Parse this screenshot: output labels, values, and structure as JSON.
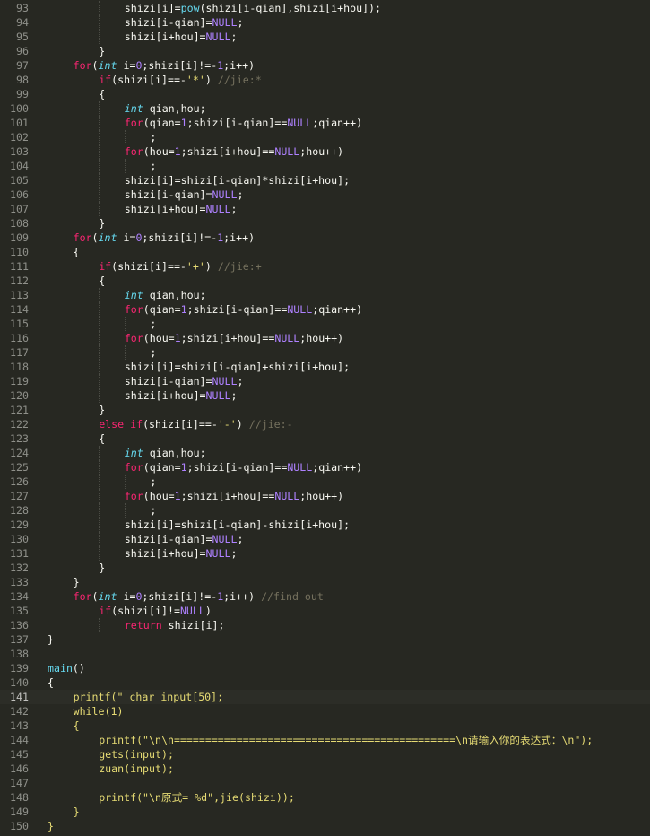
{
  "editor": {
    "theme_colors": {
      "background": "#272822",
      "text": "#f8f8f2",
      "keyword": "#f92672",
      "type": "#66d9ef",
      "number": "#ae81ff",
      "string": "#e6db74",
      "comment": "#75715e",
      "line_number": "#8f908a"
    },
    "current_line": 141,
    "lines": [
      {
        "n": "93",
        "indent": 3,
        "tokens": [
          [
            "pl",
            "shizi[i]="
          ],
          [
            "fn",
            "pow"
          ],
          [
            "pl",
            "(shizi[i-qian],shizi[i+hou]);"
          ]
        ]
      },
      {
        "n": "94",
        "indent": 3,
        "tokens": [
          [
            "pl",
            "shizi[i-qian]="
          ],
          [
            "nm",
            "NULL"
          ],
          [
            "pl",
            ";"
          ]
        ]
      },
      {
        "n": "95",
        "indent": 3,
        "tokens": [
          [
            "pl",
            "shizi[i+hou]="
          ],
          [
            "nm",
            "NULL"
          ],
          [
            "pl",
            ";"
          ]
        ]
      },
      {
        "n": "96",
        "indent": 2,
        "tokens": [
          [
            "pl",
            "}"
          ]
        ]
      },
      {
        "n": "97",
        "indent": 1,
        "tokens": [
          [
            "kw",
            "for"
          ],
          [
            "pl",
            "("
          ],
          [
            "ty",
            "int"
          ],
          [
            "pl",
            " i="
          ],
          [
            "nm",
            "0"
          ],
          [
            "pl",
            ";shizi[i]!=-"
          ],
          [
            "nm",
            "1"
          ],
          [
            "pl",
            ";i++)"
          ]
        ]
      },
      {
        "n": "98",
        "indent": 2,
        "tokens": [
          [
            "kw",
            "if"
          ],
          [
            "pl",
            "(shizi[i]==-"
          ],
          [
            "st",
            "'*'"
          ],
          [
            "pl",
            ") "
          ],
          [
            "cm",
            "//jie:*"
          ]
        ]
      },
      {
        "n": "99",
        "indent": 2,
        "tokens": [
          [
            "pl",
            "{"
          ]
        ]
      },
      {
        "n": "100",
        "indent": 3,
        "tokens": [
          [
            "ty",
            "int"
          ],
          [
            "pl",
            " qian,hou;"
          ]
        ]
      },
      {
        "n": "101",
        "indent": 3,
        "tokens": [
          [
            "kw",
            "for"
          ],
          [
            "pl",
            "(qian="
          ],
          [
            "nm",
            "1"
          ],
          [
            "pl",
            ";shizi[i-qian]=="
          ],
          [
            "nm",
            "NULL"
          ],
          [
            "pl",
            ";qian++)"
          ]
        ]
      },
      {
        "n": "102",
        "indent": 4,
        "tokens": [
          [
            "pl",
            ";"
          ]
        ]
      },
      {
        "n": "103",
        "indent": 3,
        "tokens": [
          [
            "kw",
            "for"
          ],
          [
            "pl",
            "(hou="
          ],
          [
            "nm",
            "1"
          ],
          [
            "pl",
            ";shizi[i+hou]=="
          ],
          [
            "nm",
            "NULL"
          ],
          [
            "pl",
            ";hou++)"
          ]
        ]
      },
      {
        "n": "104",
        "indent": 4,
        "tokens": [
          [
            "pl",
            ";"
          ]
        ]
      },
      {
        "n": "105",
        "indent": 3,
        "tokens": [
          [
            "pl",
            "shizi[i]=shizi[i-qian]*shizi[i+hou];"
          ]
        ]
      },
      {
        "n": "106",
        "indent": 3,
        "tokens": [
          [
            "pl",
            "shizi[i-qian]="
          ],
          [
            "nm",
            "NULL"
          ],
          [
            "pl",
            ";"
          ]
        ]
      },
      {
        "n": "107",
        "indent": 3,
        "tokens": [
          [
            "pl",
            "shizi[i+hou]="
          ],
          [
            "nm",
            "NULL"
          ],
          [
            "pl",
            ";"
          ]
        ]
      },
      {
        "n": "108",
        "indent": 2,
        "tokens": [
          [
            "pl",
            "}"
          ]
        ]
      },
      {
        "n": "109",
        "indent": 1,
        "tokens": [
          [
            "kw",
            "for"
          ],
          [
            "pl",
            "("
          ],
          [
            "ty",
            "int"
          ],
          [
            "pl",
            " i="
          ],
          [
            "nm",
            "0"
          ],
          [
            "pl",
            ";shizi[i]!=-"
          ],
          [
            "nm",
            "1"
          ],
          [
            "pl",
            ";i++)"
          ]
        ]
      },
      {
        "n": "110",
        "indent": 1,
        "tokens": [
          [
            "pl",
            "{"
          ]
        ]
      },
      {
        "n": "111",
        "indent": 2,
        "tokens": [
          [
            "kw",
            "if"
          ],
          [
            "pl",
            "(shizi[i]==-"
          ],
          [
            "st",
            "'+'"
          ],
          [
            "pl",
            ") "
          ],
          [
            "cm",
            "//jie:+"
          ]
        ]
      },
      {
        "n": "112",
        "indent": 2,
        "tokens": [
          [
            "pl",
            "{"
          ]
        ]
      },
      {
        "n": "113",
        "indent": 3,
        "tokens": [
          [
            "ty",
            "int"
          ],
          [
            "pl",
            " qian,hou;"
          ]
        ]
      },
      {
        "n": "114",
        "indent": 3,
        "tokens": [
          [
            "kw",
            "for"
          ],
          [
            "pl",
            "(qian="
          ],
          [
            "nm",
            "1"
          ],
          [
            "pl",
            ";shizi[i-qian]=="
          ],
          [
            "nm",
            "NULL"
          ],
          [
            "pl",
            ";qian++)"
          ]
        ]
      },
      {
        "n": "115",
        "indent": 4,
        "tokens": [
          [
            "pl",
            ";"
          ]
        ]
      },
      {
        "n": "116",
        "indent": 3,
        "tokens": [
          [
            "kw",
            "for"
          ],
          [
            "pl",
            "(hou="
          ],
          [
            "nm",
            "1"
          ],
          [
            "pl",
            ";shizi[i+hou]=="
          ],
          [
            "nm",
            "NULL"
          ],
          [
            "pl",
            ";hou++)"
          ]
        ]
      },
      {
        "n": "117",
        "indent": 4,
        "tokens": [
          [
            "pl",
            ";"
          ]
        ]
      },
      {
        "n": "118",
        "indent": 3,
        "tokens": [
          [
            "pl",
            "shizi[i]=shizi[i-qian]+shizi[i+hou];"
          ]
        ]
      },
      {
        "n": "119",
        "indent": 3,
        "tokens": [
          [
            "pl",
            "shizi[i-qian]="
          ],
          [
            "nm",
            "NULL"
          ],
          [
            "pl",
            ";"
          ]
        ]
      },
      {
        "n": "120",
        "indent": 3,
        "tokens": [
          [
            "pl",
            "shizi[i+hou]="
          ],
          [
            "nm",
            "NULL"
          ],
          [
            "pl",
            ";"
          ]
        ]
      },
      {
        "n": "121",
        "indent": 2,
        "tokens": [
          [
            "pl",
            "}"
          ]
        ]
      },
      {
        "n": "122",
        "indent": 2,
        "tokens": [
          [
            "kw",
            "else"
          ],
          [
            "pl",
            " "
          ],
          [
            "kw",
            "if"
          ],
          [
            "pl",
            "(shizi[i]==-"
          ],
          [
            "st",
            "'-'"
          ],
          [
            "pl",
            ") "
          ],
          [
            "cm",
            "//jie:-"
          ]
        ]
      },
      {
        "n": "123",
        "indent": 2,
        "tokens": [
          [
            "pl",
            "{"
          ]
        ]
      },
      {
        "n": "124",
        "indent": 3,
        "tokens": [
          [
            "ty",
            "int"
          ],
          [
            "pl",
            " qian,hou;"
          ]
        ]
      },
      {
        "n": "125",
        "indent": 3,
        "tokens": [
          [
            "kw",
            "for"
          ],
          [
            "pl",
            "(qian="
          ],
          [
            "nm",
            "1"
          ],
          [
            "pl",
            ";shizi[i-qian]=="
          ],
          [
            "nm",
            "NULL"
          ],
          [
            "pl",
            ";qian++)"
          ]
        ]
      },
      {
        "n": "126",
        "indent": 4,
        "tokens": [
          [
            "pl",
            ";"
          ]
        ]
      },
      {
        "n": "127",
        "indent": 3,
        "tokens": [
          [
            "kw",
            "for"
          ],
          [
            "pl",
            "(hou="
          ],
          [
            "nm",
            "1"
          ],
          [
            "pl",
            ";shizi[i+hou]=="
          ],
          [
            "nm",
            "NULL"
          ],
          [
            "pl",
            ";hou++)"
          ]
        ]
      },
      {
        "n": "128",
        "indent": 4,
        "tokens": [
          [
            "pl",
            ";"
          ]
        ]
      },
      {
        "n": "129",
        "indent": 3,
        "tokens": [
          [
            "pl",
            "shizi[i]=shizi[i-qian]-shizi[i+hou];"
          ]
        ]
      },
      {
        "n": "130",
        "indent": 3,
        "tokens": [
          [
            "pl",
            "shizi[i-qian]="
          ],
          [
            "nm",
            "NULL"
          ],
          [
            "pl",
            ";"
          ]
        ]
      },
      {
        "n": "131",
        "indent": 3,
        "tokens": [
          [
            "pl",
            "shizi[i+hou]="
          ],
          [
            "nm",
            "NULL"
          ],
          [
            "pl",
            ";"
          ]
        ]
      },
      {
        "n": "132",
        "indent": 2,
        "tokens": [
          [
            "pl",
            "}"
          ]
        ]
      },
      {
        "n": "133",
        "indent": 1,
        "tokens": [
          [
            "pl",
            "}"
          ]
        ]
      },
      {
        "n": "134",
        "indent": 1,
        "tokens": [
          [
            "kw",
            "for"
          ],
          [
            "pl",
            "("
          ],
          [
            "ty",
            "int"
          ],
          [
            "pl",
            " i="
          ],
          [
            "nm",
            "0"
          ],
          [
            "pl",
            ";shizi[i]!=-"
          ],
          [
            "nm",
            "1"
          ],
          [
            "pl",
            ";i++) "
          ],
          [
            "cm",
            "//find out"
          ]
        ]
      },
      {
        "n": "135",
        "indent": 2,
        "tokens": [
          [
            "kw",
            "if"
          ],
          [
            "pl",
            "(shizi[i]!="
          ],
          [
            "nm",
            "NULL"
          ],
          [
            "pl",
            ")"
          ]
        ]
      },
      {
        "n": "136",
        "indent": 3,
        "tokens": [
          [
            "kw",
            "return"
          ],
          [
            "pl",
            " shizi[i];"
          ]
        ]
      },
      {
        "n": "137",
        "indent": 0,
        "tokens": [
          [
            "pl",
            "}"
          ]
        ]
      },
      {
        "n": "138",
        "indent": 0,
        "tokens": []
      },
      {
        "n": "139",
        "indent": 0,
        "tokens": [
          [
            "fn",
            "main"
          ],
          [
            "pl",
            "()"
          ]
        ]
      },
      {
        "n": "140",
        "indent": 0,
        "tokens": [
          [
            "pl",
            "{"
          ]
        ]
      },
      {
        "n": "141",
        "indent": 1,
        "tokens": [
          [
            "st",
            "printf(\" char input[50];"
          ]
        ]
      },
      {
        "n": "142",
        "indent": 1,
        "tokens": [
          [
            "st",
            "while(1)"
          ]
        ]
      },
      {
        "n": "143",
        "indent": 1,
        "tokens": [
          [
            "st",
            "{"
          ]
        ]
      },
      {
        "n": "144",
        "indent": 2,
        "tokens": [
          [
            "st",
            "printf(\"\\n\\n=============================================\\n请输入你的表达式：\\n\");"
          ]
        ]
      },
      {
        "n": "145",
        "indent": 2,
        "tokens": [
          [
            "st",
            "gets(input);"
          ]
        ]
      },
      {
        "n": "146",
        "indent": 2,
        "tokens": [
          [
            "st",
            "zuan(input);"
          ]
        ]
      },
      {
        "n": "147",
        "indent": 0,
        "tokens": []
      },
      {
        "n": "148",
        "indent": 2,
        "tokens": [
          [
            "st",
            "printf(\"\\n原式= %d\",jie(shizi));"
          ]
        ]
      },
      {
        "n": "149",
        "indent": 1,
        "tokens": [
          [
            "st",
            "}"
          ]
        ]
      },
      {
        "n": "150",
        "indent": 0,
        "tokens": [
          [
            "st",
            "}"
          ]
        ]
      }
    ]
  }
}
